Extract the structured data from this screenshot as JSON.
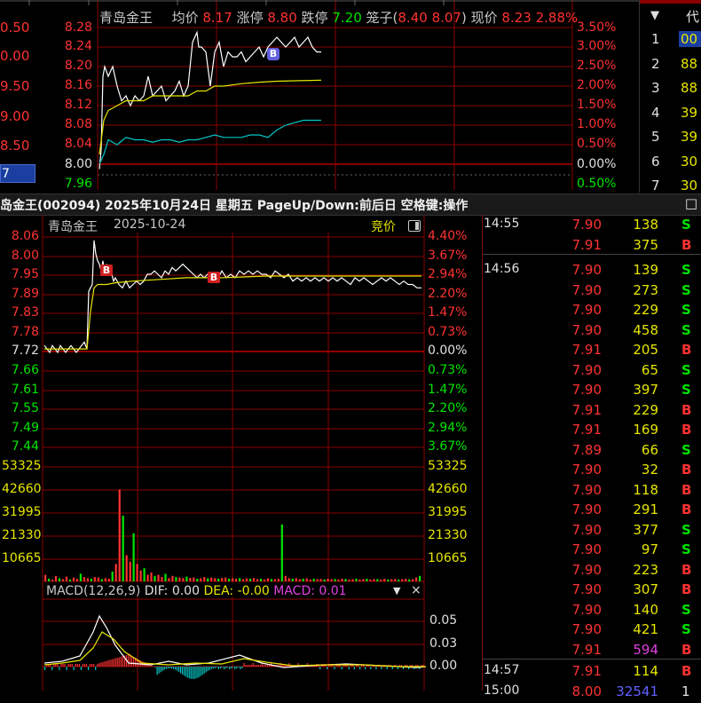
{
  "top_chart": {
    "stock_name": "青岛金王",
    "avg_label": "均价",
    "avg_value": "8.17",
    "limit_up_label": "涨停",
    "limit_up_value": "8.80",
    "limit_down_label": "跌停",
    "limit_down_value": "7.20",
    "cage_label": "笼子(",
    "cage_high": "8.40",
    "cage_low": "8.07",
    "cage_close": ")",
    "price_label": "现价",
    "price_value": "8.23",
    "pct_value": "2.88%",
    "left_partial_labels": [
      "0.50",
      "0.00",
      "9.50",
      "9.00",
      "8.50",
      "7"
    ],
    "y_labels": [
      "8.28",
      "8.24",
      "8.20",
      "8.16",
      "8.12",
      "8.08",
      "8.04",
      "8.00",
      "7.96"
    ],
    "pct_labels": [
      "3.50%",
      "3.00%",
      "2.50%",
      "2.00%",
      "1.50%",
      "1.00%",
      "0.50%",
      "0.00%",
      "0.50%"
    ],
    "b_marker": "B"
  },
  "ranking": {
    "header_arrow": "▼",
    "header_label": "代",
    "rows": [
      {
        "n": "1",
        "v": "00"
      },
      {
        "n": "2",
        "v": "88"
      },
      {
        "n": "3",
        "v": "88"
      },
      {
        "n": "4",
        "v": "39"
      },
      {
        "n": "5",
        "v": "39"
      },
      {
        "n": "6",
        "v": "30"
      },
      {
        "n": "7",
        "v": "30"
      }
    ]
  },
  "title_bar": {
    "text": "岛金王(002094) 2025年10月24日 星期五 PageUp/Down:前后日 空格键:操作",
    "close_box": "□"
  },
  "main_chart": {
    "stock_name": "青岛金王",
    "date": "2025-10-24",
    "auction_label": "竞价",
    "price_labels": [
      "8.06",
      "8.00",
      "7.95",
      "7.89",
      "7.83",
      "7.78",
      "7.72",
      "7.66",
      "7.61",
      "7.55",
      "7.49",
      "7.44"
    ],
    "pct_labels": [
      "4.40%",
      "3.67%",
      "2.94%",
      "2.20%",
      "1.47%",
      "0.73%",
      "0.00%",
      "0.73%",
      "1.47%",
      "2.20%",
      "2.94%",
      "3.67%"
    ],
    "volume_labels": [
      "53325",
      "42660",
      "31995",
      "21330",
      "10665"
    ],
    "b_markers": [
      "B",
      "B"
    ],
    "macd_title": "MACD(12,26,9)",
    "dif_label": "DIF: 0.00",
    "dea_label": "DEA: -0.00",
    "macd_label": "MACD: 0.01",
    "macd_axis": [
      "0.05",
      "0.03",
      "0.00"
    ],
    "colors": {
      "up": "#ff3232",
      "down": "#00e600",
      "price_line": "#ffffff",
      "avg_line": "#e6e600",
      "grid": "#8b0000",
      "cyan": "#00c8c8",
      "magenta": "#e040e0"
    }
  },
  "chart_data": [
    {
      "type": "line",
      "title": "",
      "series": [
        {
          "name": "现价",
          "x": [
            0,
            2,
            4,
            6,
            8,
            10,
            15,
            20,
            25,
            30,
            35,
            40,
            45,
            50,
            55,
            60,
            65,
            70,
            75,
            80,
            85,
            90,
            95,
            100,
            105,
            110,
            112,
            115,
            120,
            125,
            130,
            135,
            140,
            145,
            150,
            155,
            160,
            165,
            170,
            175,
            180,
            185,
            190,
            195,
            200,
            205,
            210,
            215,
            220,
            225,
            230,
            235,
            240,
            245,
            250
          ],
          "y": [
            7.99,
            8.03,
            8.18,
            8.2,
            8.19,
            8.18,
            8.2,
            8.16,
            8.13,
            8.14,
            8.12,
            8.14,
            8.13,
            8.14,
            8.18,
            8.14,
            8.15,
            8.16,
            8.13,
            8.14,
            8.15,
            8.17,
            8.14,
            8.16,
            8.25,
            8.27,
            8.24,
            8.24,
            8.23,
            8.16,
            8.23,
            8.25,
            8.2,
            8.23,
            8.22,
            8.22,
            8.23,
            8.21,
            8.22,
            8.23,
            8.24,
            8.22,
            8.24,
            8.25,
            8.26,
            8.25,
            8.24,
            8.25,
            8.26,
            8.24,
            8.25,
            8.26,
            8.24,
            8.23,
            8.23
          ]
        },
        {
          "name": "均价",
          "x": [
            0,
            5,
            10,
            20,
            30,
            40,
            50,
            60,
            70,
            80,
            90,
            100,
            110,
            120,
            130,
            140,
            160,
            180,
            200,
            220,
            250
          ],
          "y": [
            8.02,
            8.09,
            8.11,
            8.12,
            8.13,
            8.13,
            8.13,
            8.14,
            8.14,
            8.14,
            8.14,
            8.14,
            8.15,
            8.15,
            8.16,
            8.16,
            8.165,
            8.168,
            8.17,
            8.171,
            8.172
          ]
        },
        {
          "name": "",
          "x": [
            0,
            5,
            10,
            20,
            30,
            40,
            50,
            60,
            70,
            80,
            90,
            100,
            110,
            120,
            130,
            140,
            150,
            160,
            170,
            180,
            190,
            200,
            210,
            220,
            230,
            240,
            250
          ],
          "y": [
            8.0,
            8.02,
            8.05,
            8.04,
            8.055,
            8.05,
            8.05,
            8.045,
            8.05,
            8.05,
            8.045,
            8.05,
            8.05,
            8.055,
            8.06,
            8.055,
            8.055,
            8.055,
            8.06,
            8.06,
            8.055,
            8.07,
            8.08,
            8.085,
            8.09,
            8.09,
            8.09
          ]
        }
      ],
      "ylim": [
        7.96,
        8.3
      ]
    },
    {
      "type": "line",
      "title": "",
      "series": [
        {
          "name": "",
          "x": [
            0,
            3,
            6,
            9,
            12,
            15,
            18,
            21,
            24,
            27,
            30,
            33,
            36,
            39,
            42,
            45,
            48,
            50,
            52,
            54,
            56,
            58,
            60,
            62,
            64,
            66,
            68,
            70,
            72,
            75,
            78,
            80,
            84,
            88,
            92,
            96,
            100,
            104,
            108,
            112,
            116,
            120,
            124,
            128,
            132,
            136,
            140,
            144,
            148,
            152,
            156,
            160,
            164,
            168,
            172,
            176,
            180,
            184,
            188,
            192,
            196,
            200,
            205,
            210,
            215,
            220,
            225,
            230,
            235,
            240,
            245,
            250,
            255,
            260,
            265,
            270,
            275,
            280,
            285,
            290,
            295,
            300,
            305,
            310,
            315,
            320,
            325,
            330,
            335,
            340,
            345,
            350,
            355,
            360,
            365,
            370,
            375,
            380,
            385,
            390,
            395,
            400,
            405,
            410,
            415,
            420,
            425
          ],
          "y": [
            7.74,
            7.73,
            7.72,
            7.74,
            7.73,
            7.72,
            7.74,
            7.73,
            7.72,
            7.73,
            7.74,
            7.73,
            7.72,
            7.73,
            7.74,
            7.75,
            7.73,
            7.9,
            7.91,
            7.92,
            8.05,
            8.01,
            7.99,
            7.98,
            7.96,
            7.99,
            7.95,
            7.98,
            7.95,
            7.96,
            7.93,
            7.94,
            7.92,
            7.91,
            7.93,
            7.91,
            7.92,
            7.93,
            7.92,
            7.93,
            7.95,
            7.95,
            7.96,
            7.95,
            7.94,
            7.96,
            7.95,
            7.97,
            7.96,
            7.97,
            7.98,
            7.97,
            7.96,
            7.95,
            7.94,
            7.95,
            7.94,
            7.95,
            7.94,
            7.95,
            7.94,
            7.96,
            7.94,
            7.95,
            7.94,
            7.96,
            7.95,
            7.96,
            7.95,
            7.96,
            7.95,
            7.95,
            7.94,
            7.96,
            7.95,
            7.94,
            7.95,
            7.93,
            7.94,
            7.93,
            7.94,
            7.93,
            7.94,
            7.93,
            7.94,
            7.93,
            7.94,
            7.93,
            7.94,
            7.93,
            7.92,
            7.94,
            7.93,
            7.94,
            7.93,
            7.92,
            7.93,
            7.94,
            7.93,
            7.94,
            7.93,
            7.92,
            7.93,
            7.92,
            7.92,
            7.91,
            7.91
          ]
        },
        {
          "name": "",
          "x": [
            0,
            10,
            20,
            30,
            40,
            48,
            52,
            56,
            60,
            70,
            80,
            100,
            130,
            160,
            200,
            250,
            300,
            350,
            400,
            425
          ],
          "y": [
            7.73,
            7.73,
            7.73,
            7.73,
            7.73,
            7.73,
            7.84,
            7.91,
            7.92,
            7.92,
            7.925,
            7.93,
            7.935,
            7.94,
            7.94,
            7.945,
            7.945,
            7.945,
            7.945,
            7.945
          ]
        }
      ],
      "ylim": [
        7.44,
        8.06
      ]
    },
    {
      "type": "bar",
      "title": "",
      "yticks": [
        10665,
        21330,
        31995,
        42660,
        53325
      ],
      "ylim": [
        0,
        58000
      ],
      "values": [
        3000,
        1200,
        800,
        2500,
        1500,
        1000,
        2200,
        900,
        1800,
        1200,
        3500,
        2000,
        1500,
        1200,
        2000,
        1800,
        1000,
        1500,
        1200,
        4500,
        8000,
        42000,
        30000,
        12000,
        9000,
        22000,
        8000,
        5000,
        6000,
        3000,
        4000,
        2500,
        3000,
        2000,
        3500,
        1500,
        2500,
        2000,
        1800,
        1500,
        2200,
        1600,
        1800,
        1200,
        1500,
        2000,
        1400,
        1800,
        1500,
        1200,
        1600,
        1800,
        1200,
        1400,
        1200,
        1500,
        1000,
        1400,
        1200,
        1600,
        1000,
        1200,
        900,
        1400,
        1100,
        1000,
        1200,
        26000,
        2500,
        1500,
        1200,
        1500,
        1000,
        1200,
        1400,
        900,
        1200,
        1000,
        1100,
        900,
        1200,
        1000,
        1100,
        900,
        1200,
        1100,
        800,
        1000,
        1200,
        900,
        1000,
        1200,
        900,
        1100,
        1000,
        800,
        1200,
        900,
        1000,
        1100,
        800,
        1000,
        1200,
        900,
        1000,
        1800,
        2500
      ]
    }
  ],
  "ticks_panel": {
    "rows": [
      {
        "time": "14:55",
        "price": "7.90",
        "vol": "138",
        "side": "S"
      },
      {
        "time": "",
        "price": "7.91",
        "vol": "375",
        "side": "B"
      },
      {
        "time": "14:56",
        "price": "7.90",
        "vol": "139",
        "side": "S"
      },
      {
        "time": "",
        "price": "7.90",
        "vol": "273",
        "side": "S"
      },
      {
        "time": "",
        "price": "7.90",
        "vol": "229",
        "side": "S"
      },
      {
        "time": "",
        "price": "7.90",
        "vol": "458",
        "side": "S"
      },
      {
        "time": "",
        "price": "7.91",
        "vol": "205",
        "side": "B"
      },
      {
        "time": "",
        "price": "7.90",
        "vol": "65",
        "side": "S"
      },
      {
        "time": "",
        "price": "7.90",
        "vol": "397",
        "side": "S"
      },
      {
        "time": "",
        "price": "7.91",
        "vol": "229",
        "side": "B"
      },
      {
        "time": "",
        "price": "7.91",
        "vol": "169",
        "side": "B"
      },
      {
        "time": "",
        "price": "7.89",
        "vol": "66",
        "side": "S"
      },
      {
        "time": "",
        "price": "7.90",
        "vol": "32",
        "side": "B"
      },
      {
        "time": "",
        "price": "7.90",
        "vol": "118",
        "side": "B"
      },
      {
        "time": "",
        "price": "7.90",
        "vol": "291",
        "side": "B"
      },
      {
        "time": "",
        "price": "7.90",
        "vol": "377",
        "side": "S"
      },
      {
        "time": "",
        "price": "7.90",
        "vol": "97",
        "side": "S"
      },
      {
        "time": "",
        "price": "7.90",
        "vol": "223",
        "side": "B"
      },
      {
        "time": "",
        "price": "7.90",
        "vol": "307",
        "side": "B"
      },
      {
        "time": "",
        "price": "7.90",
        "vol": "140",
        "side": "S"
      },
      {
        "time": "",
        "price": "7.90",
        "vol": "421",
        "side": "S"
      },
      {
        "time": "",
        "price": "7.91",
        "vol": "594",
        "side": "B"
      },
      {
        "time": "14:57",
        "price": "7.91",
        "vol": "114",
        "side": "B"
      },
      {
        "time": "15:00",
        "price": "8.00",
        "vol": "32541",
        "side": "1"
      }
    ]
  }
}
